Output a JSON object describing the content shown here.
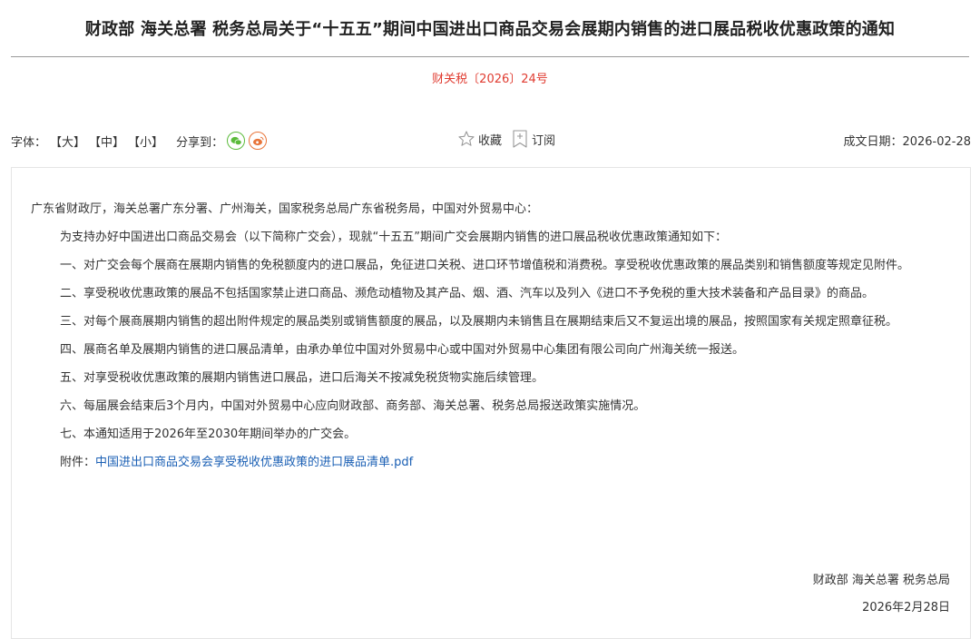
{
  "title": "财政部 海关总署 税务总局关于“十五五”期间中国进出口商品交易会展期内销售的进口展品税收优惠政策的通知",
  "doc_number": "财关税〔2026〕24号",
  "toolbar": {
    "font_label": "字体：",
    "font_large": "【大】",
    "font_medium": "【中】",
    "font_small": "【小】",
    "share_label": "分享到：",
    "favorite_label": "收藏",
    "subscribe_label": "订阅",
    "date_label": "成文日期：2026-02-28"
  },
  "body": {
    "addressee": "广东省财政厅，海关总署广东分署、广州海关，国家税务总局广东省税务局，中国对外贸易中心：",
    "paragraphs": [
      "为支持办好中国进出口商品交易会（以下简称广交会），现就“十五五”期间广交会展期内销售的进口展品税收优惠政策通知如下：",
      "一、对广交会每个展商在展期内销售的免税额度内的进口展品，免征进口关税、进口环节增值税和消费税。享受税收优惠政策的展品类别和销售额度等规定见附件。",
      "二、享受税收优惠政策的展品不包括国家禁止进口商品、濒危动植物及其产品、烟、酒、汽车以及列入《进口不予免税的重大技术装备和产品目录》的商品。",
      "三、对每个展商展期内销售的超出附件规定的展品类别或销售额度的展品，以及展期内未销售且在展期结束后又不复运出境的展品，按照国家有关规定照章征税。",
      "四、展商名单及展期内销售的进口展品清单，由承办单位中国对外贸易中心或中国对外贸易中心集团有限公司向广州海关统一报送。",
      "五、对享受税收优惠政策的展期内销售进口展品，进口后海关不按减免税货物实施后续管理。",
      "六、每届展会结束后3个月内，中国对外贸易中心应向财政部、商务部、海关总署、税务总局报送政策实施情况。",
      "七、本通知适用于2026年至2030年期间举办的广交会。"
    ],
    "attachment_label": "附件：",
    "attachment_link": "中国进出口商品交易会享受税收优惠政策的进口展品清单.pdf"
  },
  "signature": {
    "issuers": "财政部 海关总署 税务总局",
    "date": "2026年2月28日"
  },
  "colors": {
    "doc_number": "#e03c31",
    "link": "#1a5fb4",
    "wechat": "#5bbb3b",
    "weibo": "#e8753a"
  }
}
